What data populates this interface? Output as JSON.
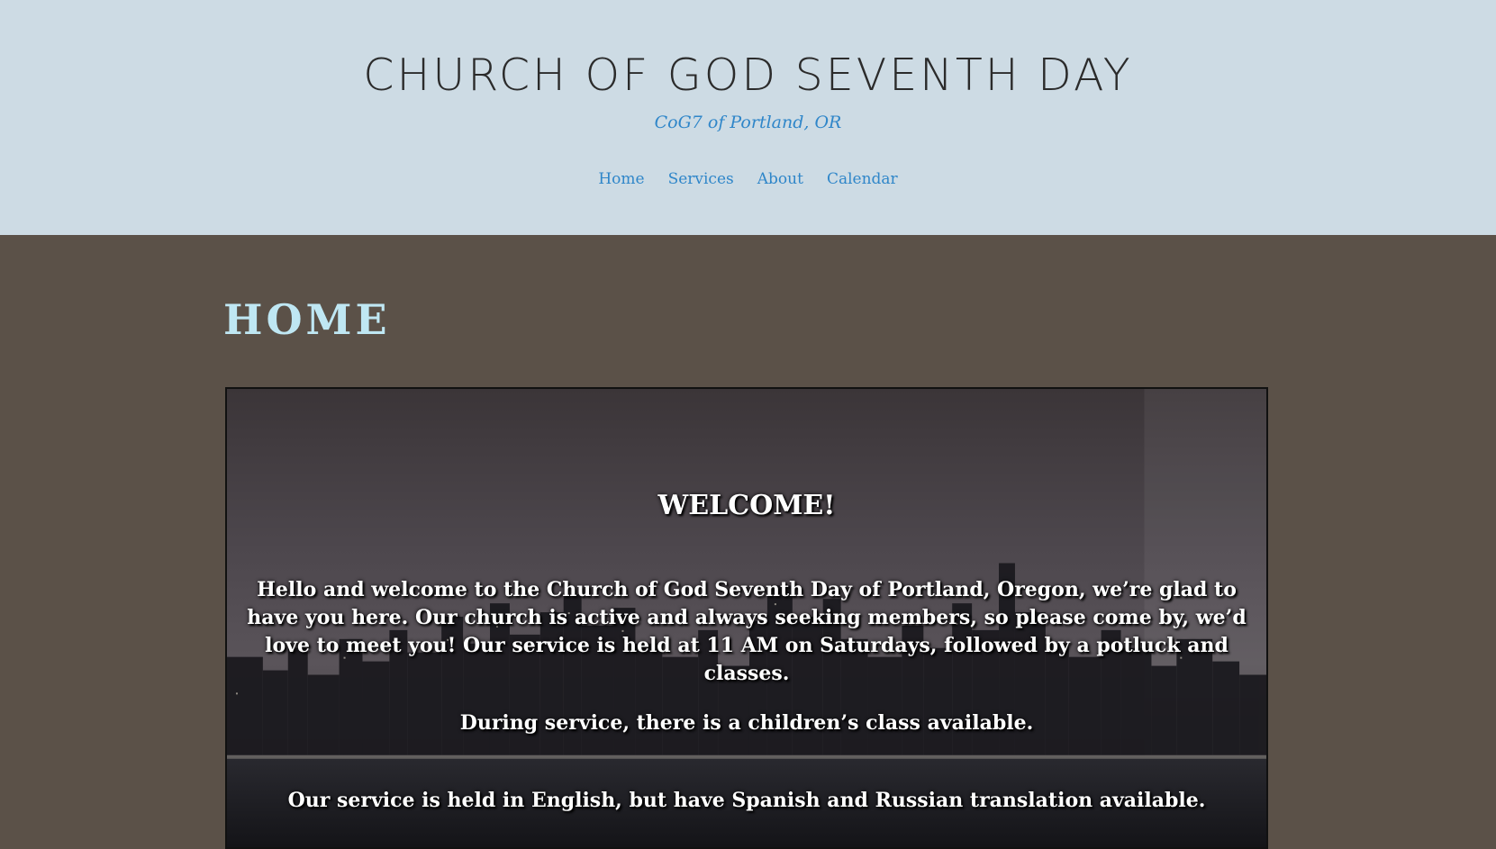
{
  "header": {
    "site_title": "CHURCH OF GOD SEVENTH DAY",
    "tagline": "CoG7 of Portland, OR"
  },
  "nav": {
    "items": [
      {
        "label": "Home"
      },
      {
        "label": "Services"
      },
      {
        "label": "About"
      },
      {
        "label": "Calendar"
      }
    ]
  },
  "main": {
    "page_title": "HOME",
    "hero": {
      "heading": "WELCOME!",
      "paragraphs": [
        "Hello and welcome to the Church of God Seventh Day of Portland, Oregon, we’re glad to have you here. Our church is active and always seeking members, so please come by, we’d love to meet you! Our service is held at 11 AM on Saturdays, followed by a potluck and classes.",
        "During service, there is a children’s class available.",
        "Our service is held in English, but have Spanish and Russian translation available."
      ],
      "background": "city skyline at night"
    }
  },
  "colors": {
    "header_bg": "#cddbe4",
    "body_bg": "#5b5148",
    "link": "#2f86c9",
    "page_title": "#bfe7f3",
    "site_title": "#2b2b2b"
  }
}
